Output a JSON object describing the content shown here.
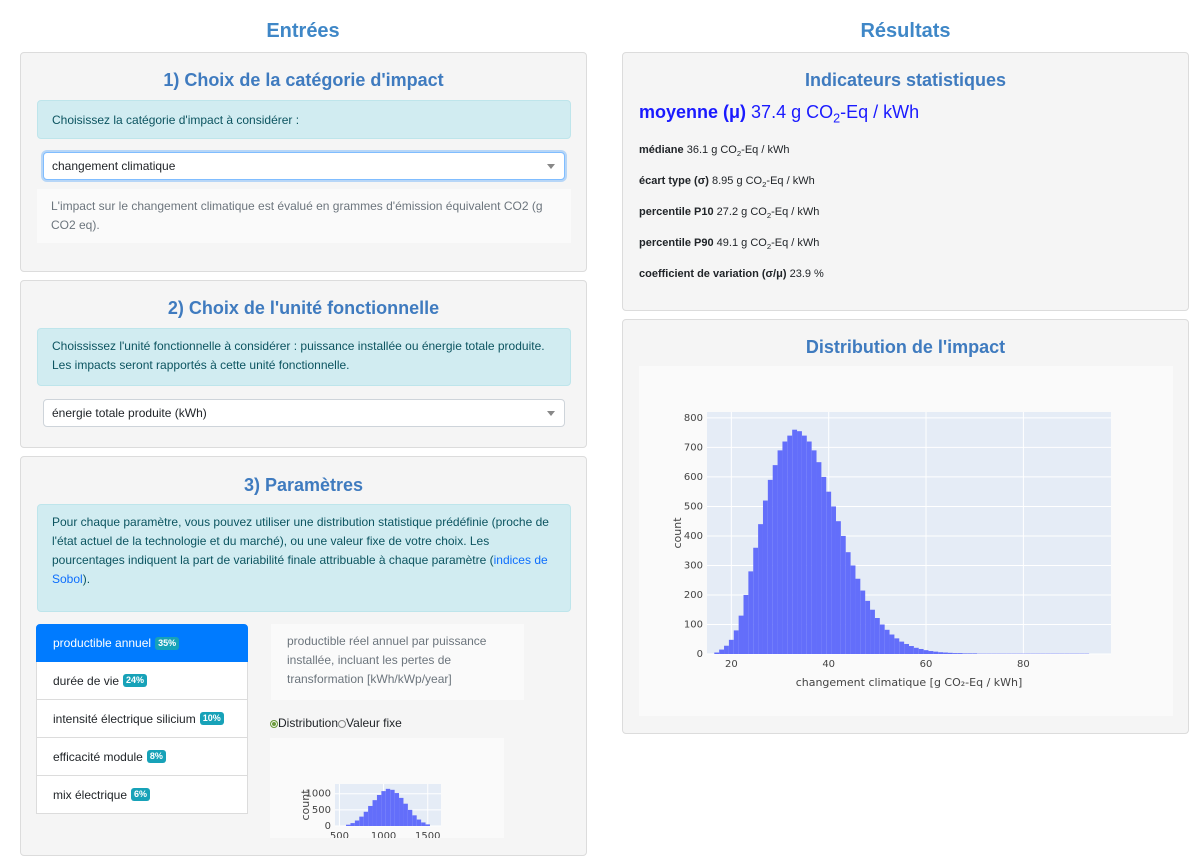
{
  "left": {
    "title": "Entrées",
    "card1": {
      "title": "1) Choix de la catégorie d'impact",
      "info": "Choisissez la catégorie d'impact à considérer :",
      "select_value": "changement climatique",
      "desc": "L'impact sur le changement climatique est évalué en grammes d'émission équivalent CO2 (g CO2 eq)."
    },
    "card2": {
      "title": "2) Choix de l'unité fonctionnelle",
      "info": "Choississez l'unité fonctionnelle à considérer : puissance installée ou énergie totale produite. Les impacts seront rapportés à cette unité fonctionnelle.",
      "select_value": "énergie totale produite (kWh)"
    },
    "card3": {
      "title": "3) Paramètres",
      "info_text": "Pour chaque paramètre, vous pouvez utiliser une distribution statistique prédéfinie (proche de l'état actuel de la technologie et du marché), ou une valeur fixe de votre choix. Les pourcentages indiquent la part de variabilité finale attribuable à chaque paramètre (",
      "info_link": "indices de Sobol",
      "info_end": ").",
      "params": [
        {
          "label": "productible annuel",
          "badge": "35%",
          "active": true
        },
        {
          "label": "durée de vie",
          "badge": "24%",
          "active": false
        },
        {
          "label": "intensité électrique silicium",
          "badge": "10%",
          "active": false
        },
        {
          "label": "efficacité module",
          "badge": "8%",
          "active": false
        },
        {
          "label": "mix électrique",
          "badge": "6%",
          "active": false
        }
      ],
      "param_desc": "productible réel annuel par puissance installée, incluant les pertes de transformation [kWh/kWp/year]",
      "radio_distribution": "Distribution",
      "radio_fixed": "Valeur fixe"
    }
  },
  "right": {
    "title": "Résultats",
    "stats": {
      "title": "Indicateurs statistiques",
      "mean_label": "moyenne (μ)",
      "mean_value": "37.4",
      "unit_prefix": "g CO",
      "unit_sub": "2",
      "unit_suffix": "-Eq / kWh",
      "rows": [
        {
          "label": "médiane",
          "value": "36.1"
        },
        {
          "label": "écart type (σ)",
          "value": "8.95"
        },
        {
          "label": "percentile P10",
          "value": "27.2"
        },
        {
          "label": "percentile P90",
          "value": "49.1"
        }
      ],
      "cv_label": "coefficient de variation (σ/μ)",
      "cv_value": "23.9 %"
    },
    "dist_title": "Distribution de l'impact"
  },
  "colors": {
    "accent": "#3f7bbf",
    "bar": "#636efa",
    "active": "#007bff",
    "badge": "#17a2b8"
  },
  "chart_data": [
    {
      "type": "bar",
      "ylabel": "count",
      "xlabel": "changement climatique [g CO₂-Eq / kWh]",
      "xlim": [
        15,
        98
      ],
      "ylim": [
        0,
        820
      ],
      "xticks": [
        20,
        40,
        60,
        80
      ],
      "yticks": [
        0,
        100,
        200,
        300,
        400,
        500,
        600,
        700,
        800
      ],
      "points": [
        [
          16,
          0
        ],
        [
          17,
          5
        ],
        [
          18,
          15
        ],
        [
          19,
          28
        ],
        [
          20,
          48
        ],
        [
          21,
          80
        ],
        [
          22,
          130
        ],
        [
          23,
          200
        ],
        [
          24,
          280
        ],
        [
          25,
          360
        ],
        [
          26,
          440
        ],
        [
          27,
          520
        ],
        [
          28,
          590
        ],
        [
          29,
          640
        ],
        [
          30,
          690
        ],
        [
          31,
          720
        ],
        [
          32,
          740
        ],
        [
          33,
          760
        ],
        [
          34,
          755
        ],
        [
          35,
          740
        ],
        [
          36,
          720
        ],
        [
          37,
          690
        ],
        [
          38,
          650
        ],
        [
          39,
          600
        ],
        [
          40,
          550
        ],
        [
          41,
          500
        ],
        [
          42,
          450
        ],
        [
          43,
          400
        ],
        [
          44,
          345
        ],
        [
          45,
          300
        ],
        [
          46,
          255
        ],
        [
          47,
          215
        ],
        [
          48,
          180
        ],
        [
          49,
          150
        ],
        [
          50,
          122
        ],
        [
          51,
          100
        ],
        [
          52,
          82
        ],
        [
          53,
          66
        ],
        [
          54,
          53
        ],
        [
          55,
          42
        ],
        [
          56,
          34
        ],
        [
          57,
          27
        ],
        [
          58,
          21
        ],
        [
          59,
          17
        ],
        [
          60,
          13
        ],
        [
          61,
          10
        ],
        [
          62,
          8
        ],
        [
          63,
          6
        ],
        [
          64,
          5
        ],
        [
          65,
          4
        ],
        [
          66,
          3
        ],
        [
          67,
          3
        ],
        [
          68,
          2
        ],
        [
          69,
          2
        ],
        [
          70,
          2
        ],
        [
          71,
          1
        ],
        [
          72,
          1
        ],
        [
          73,
          1
        ],
        [
          74,
          1
        ],
        [
          75,
          1
        ],
        [
          76,
          1
        ],
        [
          77,
          1
        ],
        [
          78,
          1
        ],
        [
          79,
          1
        ],
        [
          80,
          1
        ],
        [
          81,
          1
        ],
        [
          82,
          1
        ],
        [
          83,
          1
        ],
        [
          84,
          1
        ],
        [
          85,
          1
        ],
        [
          86,
          1
        ],
        [
          87,
          1
        ],
        [
          88,
          1
        ],
        [
          89,
          1
        ],
        [
          90,
          1
        ],
        [
          91,
          1
        ],
        [
          92,
          1
        ],
        [
          93,
          1
        ],
        [
          94,
          0
        ],
        [
          95,
          0
        ]
      ]
    },
    {
      "type": "bar",
      "ylabel": "count",
      "xlabel": "",
      "xlim": [
        450,
        1650
      ],
      "ylim": [
        0,
        1300
      ],
      "xticks": [
        500,
        1000,
        1500
      ],
      "yticks": [
        0,
        500,
        1000
      ],
      "points": [
        [
          600,
          40
        ],
        [
          650,
          90
        ],
        [
          700,
          170
        ],
        [
          750,
          290
        ],
        [
          800,
          440
        ],
        [
          850,
          620
        ],
        [
          900,
          800
        ],
        [
          950,
          960
        ],
        [
          1000,
          1080
        ],
        [
          1050,
          1150
        ],
        [
          1100,
          1120
        ],
        [
          1150,
          1020
        ],
        [
          1200,
          870
        ],
        [
          1250,
          690
        ],
        [
          1300,
          500
        ],
        [
          1350,
          330
        ],
        [
          1400,
          200
        ],
        [
          1450,
          110
        ],
        [
          1500,
          50
        ]
      ]
    }
  ]
}
